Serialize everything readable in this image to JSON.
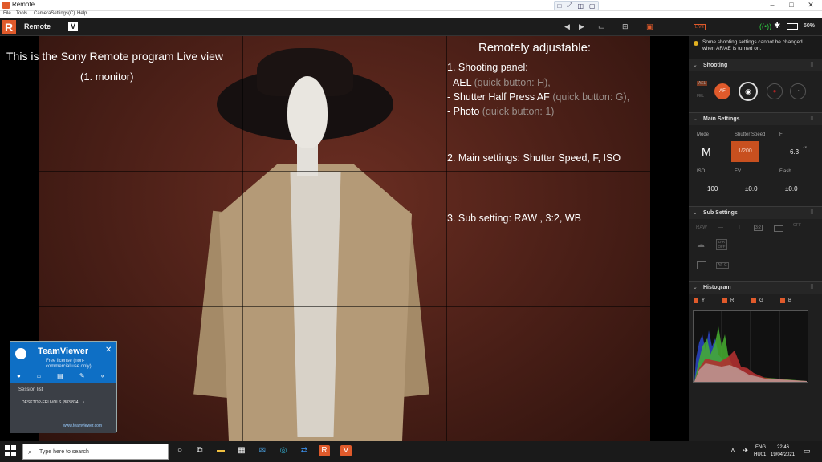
{
  "window": {
    "title": "Remote",
    "controls": [
      "–",
      "□",
      "✕"
    ]
  },
  "menu": [
    "File",
    "Tools",
    "CameraSettings(C)",
    "Help"
  ],
  "teamviewer_bar": [
    "□",
    "⤢",
    "◫",
    "▢"
  ],
  "toolbar": {
    "logo": "R",
    "app_name": "Remote",
    "v_button": "V",
    "icons": [
      "◀",
      "▶",
      "▭",
      "⊞",
      "▣"
    ],
    "live_badge": "LIVE",
    "battery_text": "60%"
  },
  "overlay": {
    "title_line1": "This is the Sony Remote program Live view",
    "title_line2": "(1. monitor)",
    "adjustable_title": "Remotely adjustable:",
    "shooting_panel": "1. Shooting panel:",
    "ael_prefix": "- AEL",
    "ael_hint": "(quick button: H),",
    "shutter_prefix": "- Shutter Half Press AF",
    "shutter_hint": "(quick button: G),",
    "photo_prefix": "- Photo",
    "photo_hint": "(quick button: 1)",
    "main_settings": "2. Main settings: Shutter Speed, F, ISO",
    "sub_setting": "3. Sub setting: RAW , 3:2, WB"
  },
  "teamviewer": {
    "name": "TeamViewer",
    "sub": "Free license (non-commercial use only)",
    "close": "✕",
    "icons": "● ⌂ ▤ ✎ «",
    "session_label": "Session list",
    "session_item": "DESKTOP-ERUVOLS (883 834 ...)",
    "url": "www.teamviewer.com"
  },
  "panel": {
    "warning": "Some shooting settings cannot be changed when AF/AE is turned on.",
    "shooting": {
      "label": "Shooting",
      "ael": "AEL",
      "fel": "FEL",
      "af": "AF"
    },
    "main": {
      "label": "Main Settings",
      "mode_label": "Mode",
      "mode_value": "M",
      "shutter_label": "Shutter Speed",
      "shutter_value": "1/200",
      "f_label": "F",
      "f_value": "6.3",
      "iso_label": "ISO",
      "iso_value": "100",
      "ev_label": "EV",
      "ev_value": "±0.0",
      "flash_label": "Flash",
      "flash_value": "±0.0"
    },
    "sub": {
      "label": "Sub Settings",
      "raw": "RAW",
      "dash": "—",
      "l": "L",
      "ratio": "3:2",
      "dro": "D-R OFF",
      "off": "OFF",
      "afc": "AF-C"
    },
    "histogram": {
      "label": "Histogram",
      "channels": [
        "Y",
        "R",
        "G",
        "B"
      ]
    }
  },
  "taskbar": {
    "search_placeholder": "Type here to search",
    "lang": "ENG",
    "layout": "HU01",
    "time": "22:46",
    "date": "19/04/2021"
  }
}
